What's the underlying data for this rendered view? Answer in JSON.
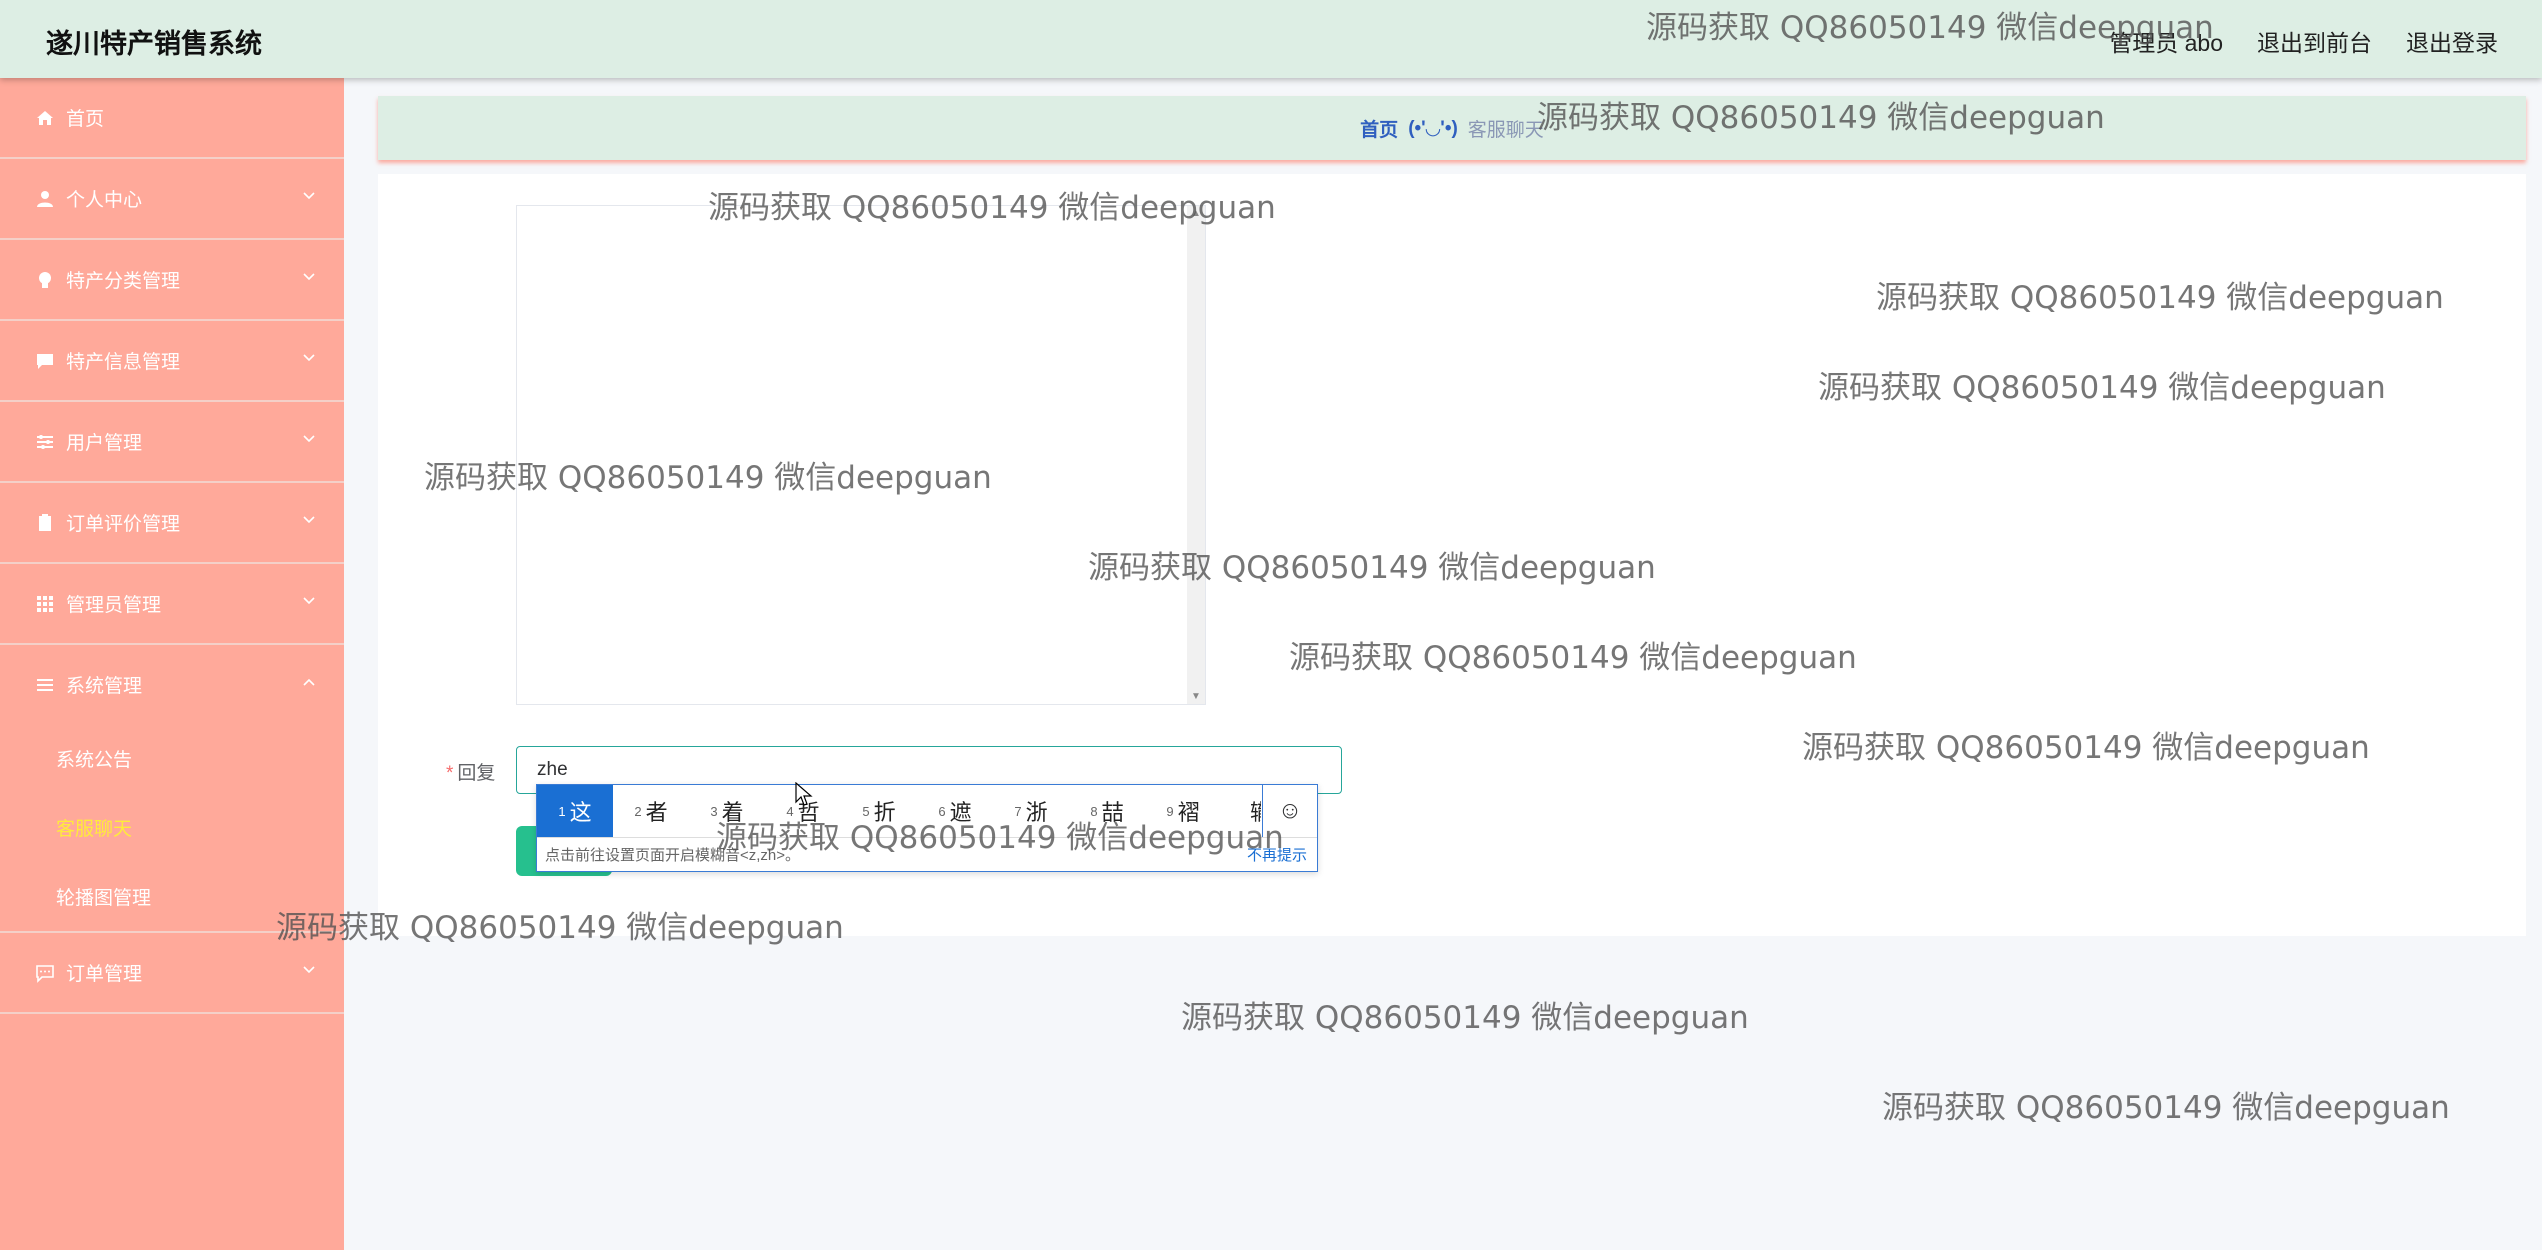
{
  "header": {
    "title": "遂川特产销售系统",
    "links": [
      "管理员 abo",
      "退出到前台",
      "退出登录"
    ]
  },
  "sidebar": {
    "items": [
      {
        "label": "首页",
        "icon": "home-icon",
        "has_chevron": false
      },
      {
        "label": "个人中心",
        "icon": "user-icon",
        "has_chevron": true
      },
      {
        "label": "特产分类管理",
        "icon": "bulb-icon",
        "has_chevron": true
      },
      {
        "label": "特产信息管理",
        "icon": "message-icon",
        "has_chevron": true
      },
      {
        "label": "用户管理",
        "icon": "sliders-icon",
        "has_chevron": true
      },
      {
        "label": "订单评价管理",
        "icon": "clipboard-icon",
        "has_chevron": true
      },
      {
        "label": "管理员管理",
        "icon": "grid-icon",
        "has_chevron": true
      },
      {
        "label": "系统管理",
        "icon": "menu-icon",
        "has_chevron": true,
        "expanded": true
      }
    ],
    "submenu": [
      "系统公告",
      "客服聊天",
      "轮播图管理"
    ],
    "active_submenu": "客服聊天",
    "last_item": {
      "label": "订单管理",
      "icon": "chat-icon"
    }
  },
  "breadcrumb": {
    "home": "首页",
    "face": "(•'◡'•)",
    "current": "客服聊天"
  },
  "form": {
    "reply_label": "回复",
    "reply_value": "zhe"
  },
  "ime": {
    "candidates": [
      {
        "num": "1",
        "char": "这"
      },
      {
        "num": "2",
        "char": "者"
      },
      {
        "num": "3",
        "char": "着"
      },
      {
        "num": "4",
        "char": "哲"
      },
      {
        "num": "5",
        "char": "折"
      },
      {
        "num": "6",
        "char": "遮"
      },
      {
        "num": "7",
        "char": "浙"
      },
      {
        "num": "8",
        "char": "喆"
      },
      {
        "num": "9",
        "char": "褶"
      },
      {
        "num": "",
        "char": "辙"
      }
    ],
    "emoji": "☺",
    "tip": "点击前往设置页面开启模糊音<z,zh>。",
    "dismiss": "不再提示"
  },
  "watermark_text": "源码获取 QQ86050149 微信deepguan",
  "colors": {
    "sidebar_bg": "#ffa99a",
    "header_bg": "#ddeee4",
    "active_submenu": "#ffeb3b",
    "accent": "#26c08e"
  }
}
